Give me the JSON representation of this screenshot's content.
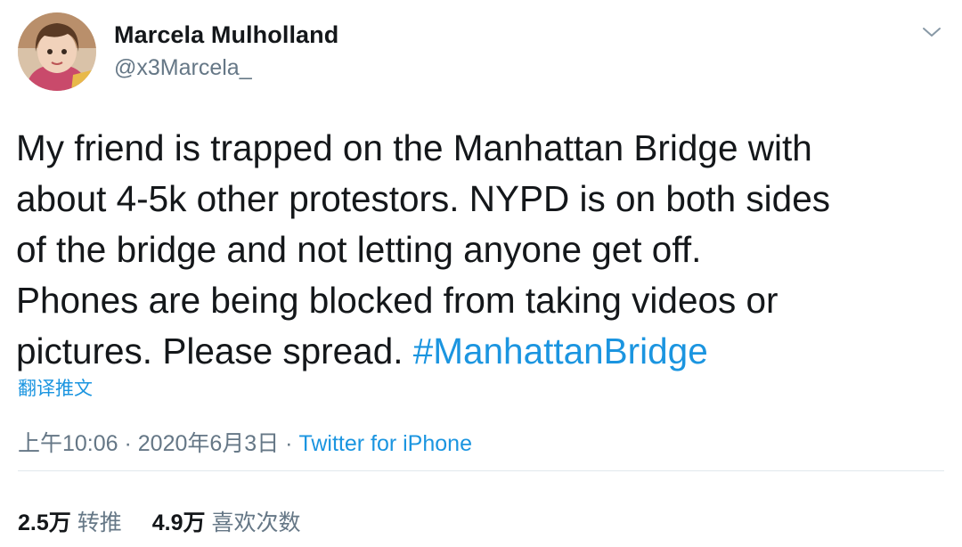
{
  "author": {
    "display_name": "Marcela Mulholland",
    "handle": "@x3Marcela_",
    "avatar_icon": "profile-photo"
  },
  "menu_icon": "chevron-down-icon",
  "tweet": {
    "lines": [
      "My friend is trapped on the Manhattan Bridge with",
      "about 4-5k other protestors. NYPD is on both sides",
      "of the bridge and not letting anyone get off.",
      "Phones are being blocked from taking videos or",
      "pictures. Please spread. "
    ],
    "hashtag": "#ManhattanBridge"
  },
  "translate_label": "翻译推文",
  "meta": {
    "time": "上午10:06",
    "separator": " · ",
    "date": "2020年6月3日",
    "separator2": " · ",
    "source": "Twitter for iPhone"
  },
  "stats": {
    "retweets_count": "2.5万",
    "retweets_label": "转推",
    "likes_count": "4.9万",
    "likes_label": "喜欢次数"
  },
  "colors": {
    "link": "#1b95e0",
    "secondary_text": "#657786",
    "primary_text": "#14171a",
    "divider": "#e1e8ed"
  }
}
